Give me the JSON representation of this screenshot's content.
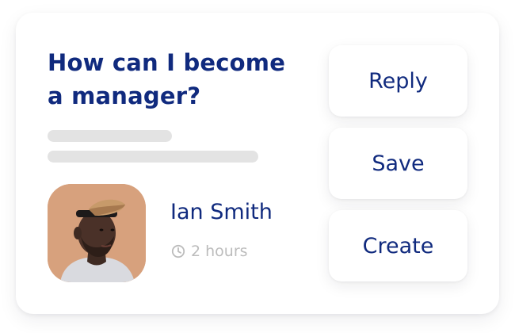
{
  "question": {
    "title": "How can I become a manager?"
  },
  "author": {
    "name": "Ian Smith",
    "time": "2 hours",
    "time_icon": "clock-icon",
    "avatar_bg": "#d7a17d"
  },
  "actions": [
    {
      "label": "Reply"
    },
    {
      "label": "Save"
    },
    {
      "label": "Create"
    }
  ],
  "colors": {
    "primary_text": "#102a7e",
    "muted_text": "#bcbcbc",
    "placeholder": "#e3e3e3",
    "card_bg": "#ffffff"
  }
}
